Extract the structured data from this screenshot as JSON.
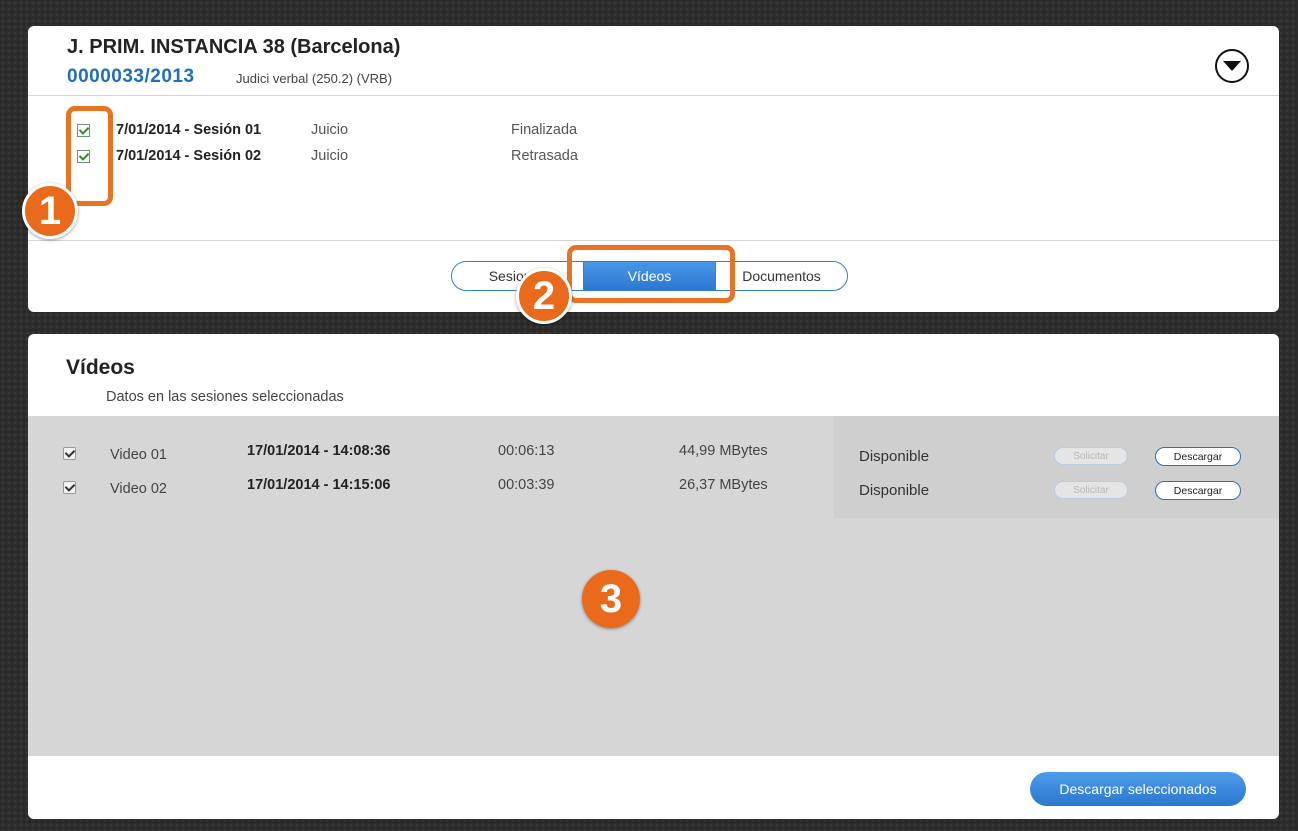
{
  "case": {
    "court": "J. PRIM. INSTANCIA 38 (Barcelona)",
    "number": "0000033/2013",
    "type": "Judici verbal (250.2) (VRB)"
  },
  "sessions": [
    {
      "date": "7/01/2014 - Sesión 01",
      "type": "Juicio",
      "status": "Finalizada",
      "checked": true
    },
    {
      "date": "7/01/2014 - Sesión 02",
      "type": "Juicio",
      "status": "Retrasada",
      "checked": true
    }
  ],
  "tabs": [
    {
      "label": "Sesiones",
      "active": false
    },
    {
      "label": "Vídeos",
      "active": true
    },
    {
      "label": "Documentos",
      "active": false
    }
  ],
  "videos_section": {
    "title": "Vídeos",
    "subtitle": "Datos en las sesiones seleccionadas",
    "items": [
      {
        "name": "Video 01",
        "datetime": "17/01/2014 - 14:08:36",
        "duration": "00:06:13",
        "size": "44,99 MBytes",
        "status": "Disponible",
        "request_label": "Solicitar",
        "download_label": "Descargar",
        "checked": true
      },
      {
        "name": "Video 02",
        "datetime": "17/01/2014 - 14:15:06",
        "duration": "00:03:39",
        "size": "26,37 MBytes",
        "status": "Disponible",
        "request_label": "Solicitar",
        "download_label": "Descargar",
        "checked": true
      }
    ],
    "bulk_download_label": "Descargar seleccionados"
  },
  "callouts": [
    "1",
    "2",
    "3"
  ],
  "colors": {
    "accent": "#2c78d2",
    "callout": "#ea6a1c",
    "case_number": "#1f6fc1"
  }
}
